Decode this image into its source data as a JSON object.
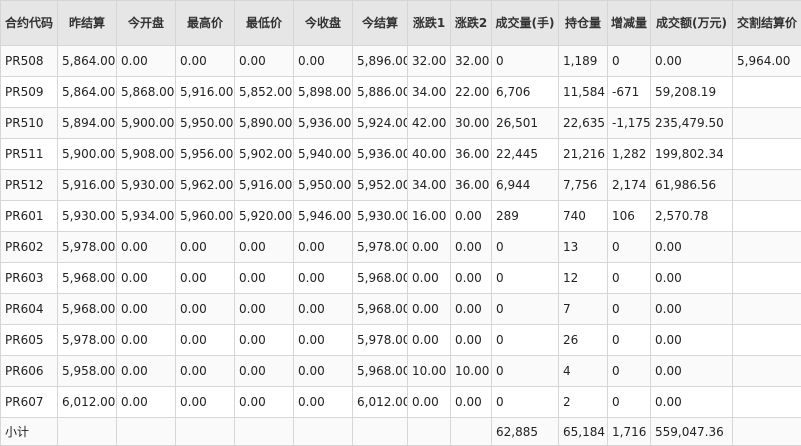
{
  "headers": [
    "合约代码",
    "昨结算",
    "今开盘",
    "最高价",
    "最低价",
    "今收盘",
    "今结算",
    "涨跌1",
    "涨跌2",
    "成交量(手)",
    "持仓量",
    "增减量",
    "成交额(万元)",
    "交割结算价"
  ],
  "rows": [
    [
      "PR508",
      "5,864.00",
      "0.00",
      "0.00",
      "0.00",
      "0.00",
      "5,896.00",
      "32.00",
      "32.00",
      "0",
      "1,189",
      "0",
      "0.00",
      "5,964.00"
    ],
    [
      "PR509",
      "5,864.00",
      "5,868.00",
      "5,916.00",
      "5,852.00",
      "5,898.00",
      "5,886.00",
      "34.00",
      "22.00",
      "6,706",
      "11,584",
      "-671",
      "59,208.19",
      ""
    ],
    [
      "PR510",
      "5,894.00",
      "5,900.00",
      "5,950.00",
      "5,890.00",
      "5,936.00",
      "5,924.00",
      "42.00",
      "30.00",
      "26,501",
      "22,635",
      "-1,175",
      "235,479.50",
      ""
    ],
    [
      "PR511",
      "5,900.00",
      "5,908.00",
      "5,956.00",
      "5,902.00",
      "5,940.00",
      "5,936.00",
      "40.00",
      "36.00",
      "22,445",
      "21,216",
      "1,282",
      "199,802.34",
      ""
    ],
    [
      "PR512",
      "5,916.00",
      "5,930.00",
      "5,962.00",
      "5,916.00",
      "5,950.00",
      "5,952.00",
      "34.00",
      "36.00",
      "6,944",
      "7,756",
      "2,174",
      "61,986.56",
      ""
    ],
    [
      "PR601",
      "5,930.00",
      "5,934.00",
      "5,960.00",
      "5,920.00",
      "5,946.00",
      "5,930.00",
      "16.00",
      "0.00",
      "289",
      "740",
      "106",
      "2,570.78",
      ""
    ],
    [
      "PR602",
      "5,978.00",
      "0.00",
      "0.00",
      "0.00",
      "0.00",
      "5,978.00",
      "0.00",
      "0.00",
      "0",
      "13",
      "0",
      "0.00",
      ""
    ],
    [
      "PR603",
      "5,968.00",
      "0.00",
      "0.00",
      "0.00",
      "0.00",
      "5,968.00",
      "0.00",
      "0.00",
      "0",
      "12",
      "0",
      "0.00",
      ""
    ],
    [
      "PR604",
      "5,968.00",
      "0.00",
      "0.00",
      "0.00",
      "0.00",
      "5,968.00",
      "0.00",
      "0.00",
      "0",
      "7",
      "0",
      "0.00",
      ""
    ],
    [
      "PR605",
      "5,978.00",
      "0.00",
      "0.00",
      "0.00",
      "0.00",
      "5,978.00",
      "0.00",
      "0.00",
      "0",
      "26",
      "0",
      "0.00",
      ""
    ],
    [
      "PR606",
      "5,958.00",
      "0.00",
      "0.00",
      "0.00",
      "0.00",
      "5,968.00",
      "10.00",
      "10.00",
      "0",
      "4",
      "0",
      "0.00",
      ""
    ],
    [
      "PR607",
      "6,012.00",
      "0.00",
      "0.00",
      "0.00",
      "0.00",
      "6,012.00",
      "0.00",
      "0.00",
      "0",
      "2",
      "0",
      "0.00",
      ""
    ]
  ],
  "total": [
    "小计",
    "",
    "",
    "",
    "",
    "",
    "",
    "",
    "",
    "62,885",
    "65,184",
    "1,716",
    "559,047.36",
    ""
  ]
}
